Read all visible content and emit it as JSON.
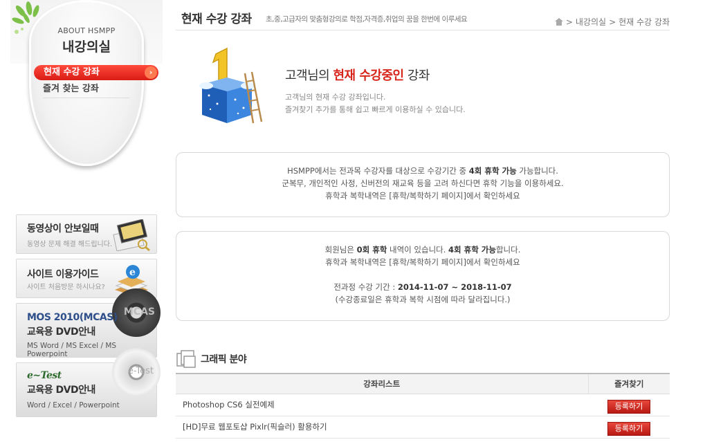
{
  "sidebar": {
    "about_label": "ABOUT HSMPP",
    "title": "내강의실",
    "menu": [
      {
        "label": "현재 수강 강좌",
        "active": true
      },
      {
        "label": "즐겨 찾는 강좌",
        "active": false
      }
    ],
    "banners": [
      {
        "title": "동영상이 안보일때",
        "sub": "동영상 문제 해결 해드립니다."
      },
      {
        "title": "사이트 이용가이드",
        "sub": "사이트 처음방문 하시나요?"
      },
      {
        "title": "MOS 2010(MCAS)",
        "title2": "교육용 DVD안내",
        "sub": "MS Word / MS Excel / MS Powerpoint",
        "disc_label": "MCAS"
      },
      {
        "title": "e~Test",
        "title2": "교육용 DVD안내",
        "sub": "Word / Excel / Powerpoint",
        "disc_label": "e-Test"
      }
    ]
  },
  "header": {
    "title": "현재 수강 강좌",
    "subtitle": "초,중,고급자의 맞춤형강의로 학점,자격증,취업의 꿈을 한번에 이루세요",
    "breadcrumb": [
      "내강의실",
      "현재 수강 강좌"
    ]
  },
  "hero": {
    "title_pre": "고객님의 ",
    "title_hl": "현재 수강중인",
    "title_post": " 강좌",
    "line1": "고객님의 현재 수강 강좌입니다.",
    "line2": "즐겨찾기 추가를 통해 쉽고 빠르게 이용하실 수 있습니다."
  },
  "notice1": {
    "l1_pre": "HSMPP에서는 전과목 수강자를 대상으로 수강기간 중 ",
    "l1_bold": "4회 휴학 가능",
    "l1_post": " 가능합니다.",
    "l2": "군복무, 개인적인 사정, 신버전의 재교육 등을 고려 하신다면 휴학 기능을 이용하세요.",
    "l3": "휴학과 복학내역은 [휴학/복학하기 페이지]에서 확인하세요"
  },
  "notice2": {
    "l1_pre": "회원님은 ",
    "l1_b1": "0회 휴학",
    "l1_mid": " 내역이 있습니다. ",
    "l1_b2": "4회 휴학 가능",
    "l1_post": "합니다.",
    "l2": "휴학과 복학내역은 [휴학/복학하기 페이지]에서 확인하세요",
    "l3_pre": "전과정 수강 기간 : ",
    "l3_bold": "2014-11-07 ~ 2018-11-07",
    "l4": "(수강종료일은 휴학과 복학 시점에 따라 달라집니다.)"
  },
  "section": {
    "title": "그래픽 분야"
  },
  "table": {
    "headers": [
      "강좌리스트",
      "즐겨찾기"
    ],
    "rows": [
      {
        "name": "Photoshop CS6 실전예제",
        "action": "등록하기"
      },
      {
        "name": "[HD]무료 웹포토샵 Pixlr(픽슬러) 활용하기",
        "action": "등록하기"
      }
    ]
  },
  "colors": {
    "accent": "#d8251b",
    "button": "#c8261c"
  }
}
